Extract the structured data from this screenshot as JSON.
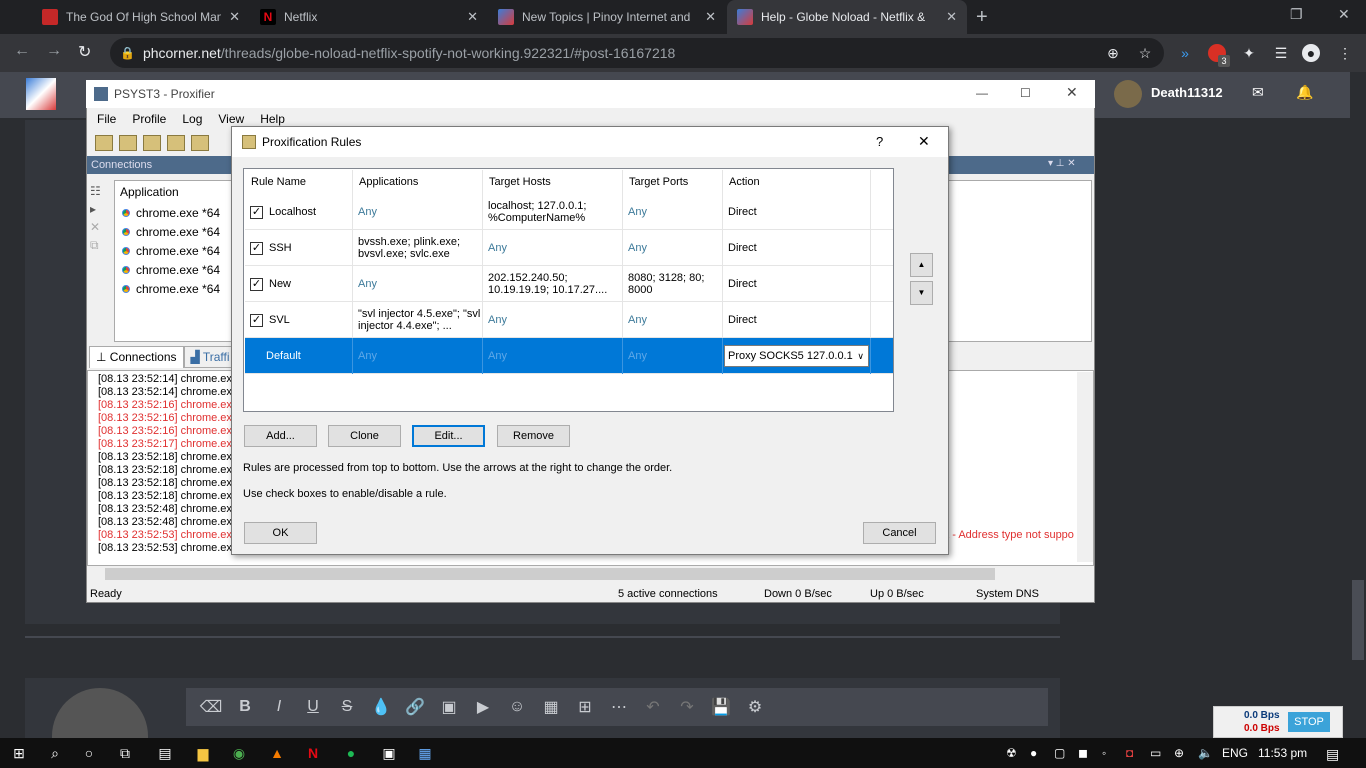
{
  "browser": {
    "tabs": [
      {
        "title": "The God Of High School Manga",
        "close": "✕",
        "active": false
      },
      {
        "title": "Netflix",
        "close": "✕",
        "active": false
      },
      {
        "title": "New Topics | Pinoy Internet and",
        "close": "✕",
        "active": false
      },
      {
        "title": "Help - Globe Noload - Netflix &",
        "close": "✕",
        "active": true
      }
    ],
    "new_tab": "+",
    "url_host": "phcorner.net",
    "url_path": "/threads/globe-noload-netflix-spotify-not-working.922321/#post-16167218",
    "badge_count": "3"
  },
  "site": {
    "username": "Death11312"
  },
  "proxifier": {
    "title": "PSYST3 - Proxifier",
    "menu": [
      "File",
      "Profile",
      "Log",
      "View",
      "Help"
    ],
    "connections_header": "Connections",
    "app_column": "Application",
    "apps": [
      "chrome.exe *64",
      "chrome.exe *64",
      "chrome.exe *64",
      "chrome.exe *64",
      "chrome.exe *64"
    ],
    "tabs": [
      "Connections",
      "Traffi"
    ],
    "log": [
      {
        "text": "[08.13 23:52:14] chrome.exe",
        "error": false
      },
      {
        "text": "[08.13 23:52:14] chrome.exe",
        "error": false
      },
      {
        "text": "[08.13 23:52:16] chrome.exe",
        "error": true
      },
      {
        "text": "[08.13 23:52:16] chrome.exe",
        "error": true
      },
      {
        "text": "[08.13 23:52:16] chrome.exe",
        "error": true
      },
      {
        "text": "[08.13 23:52:17] chrome.exe",
        "error": true
      },
      {
        "text": "[08.13 23:52:18] chrome.exe",
        "error": false
      },
      {
        "text": "[08.13 23:52:18] chrome.exe",
        "error": false
      },
      {
        "text": "[08.13 23:52:18] chrome.exe",
        "error": false
      },
      {
        "text": "[08.13 23:52:18] chrome.exe",
        "error": false
      },
      {
        "text": "[08.13 23:52:48] chrome.exe",
        "error": false
      },
      {
        "text": "[08.13 23:52:48] chrome.exe",
        "error": false
      },
      {
        "text": "[08.13 23:52:53] chrome.exe",
        "error": true
      },
      {
        "text": "[08.13 23:52:53] chrome.exe",
        "error": false
      }
    ],
    "log_tail_error": "et - Address type not suppo",
    "status": {
      "ready": "Ready",
      "active": "5 active connections",
      "down": "Down 0 B/sec",
      "up": "Up 0 B/sec",
      "dns": "System DNS"
    }
  },
  "dialog": {
    "title": "Proxification Rules",
    "help": "?",
    "close": "✕",
    "columns": [
      "Rule Name",
      "Applications",
      "Target Hosts",
      "Target Ports",
      "Action"
    ],
    "rules": [
      {
        "name": "Localhost",
        "checked": true,
        "apps": "Any",
        "hosts": "localhost; 127.0.0.1; %ComputerName%",
        "ports": "Any",
        "action": "Direct"
      },
      {
        "name": "SSH",
        "checked": true,
        "apps": "bvssh.exe; plink.exe; bvsvl.exe; svlc.exe",
        "hosts": "Any",
        "ports": "Any",
        "action": "Direct"
      },
      {
        "name": "New",
        "checked": true,
        "apps": "Any",
        "hosts": "202.152.240.50; 10.19.19.19; 10.17.27....",
        "ports": "8080; 3128; 80; 8000",
        "action": "Direct"
      },
      {
        "name": "SVL",
        "checked": true,
        "apps": "\"svl injector 4.5.exe\"; \"svl injector 4.4.exe\"; ...",
        "hosts": "Any",
        "ports": "Any",
        "action": "Direct"
      },
      {
        "name": "Default",
        "checked": false,
        "apps": "Any",
        "hosts": "Any",
        "ports": "Any",
        "action": "Proxy SOCKS5 127.0.0.1"
      }
    ],
    "buttons": {
      "add": "Add...",
      "clone": "Clone",
      "edit": "Edit...",
      "remove": "Remove",
      "ok": "OK",
      "cancel": "Cancel"
    },
    "note1": "Rules are processed from top to bottom. Use the arrows at the right to change the order.",
    "note2": "Use check boxes to enable/disable a rule."
  },
  "netmeter": {
    "down": "0.0 Bps",
    "up": "0.0 Bps",
    "stop": "STOP"
  },
  "taskbar": {
    "lang": "ENG",
    "time": "11:53 pm"
  }
}
